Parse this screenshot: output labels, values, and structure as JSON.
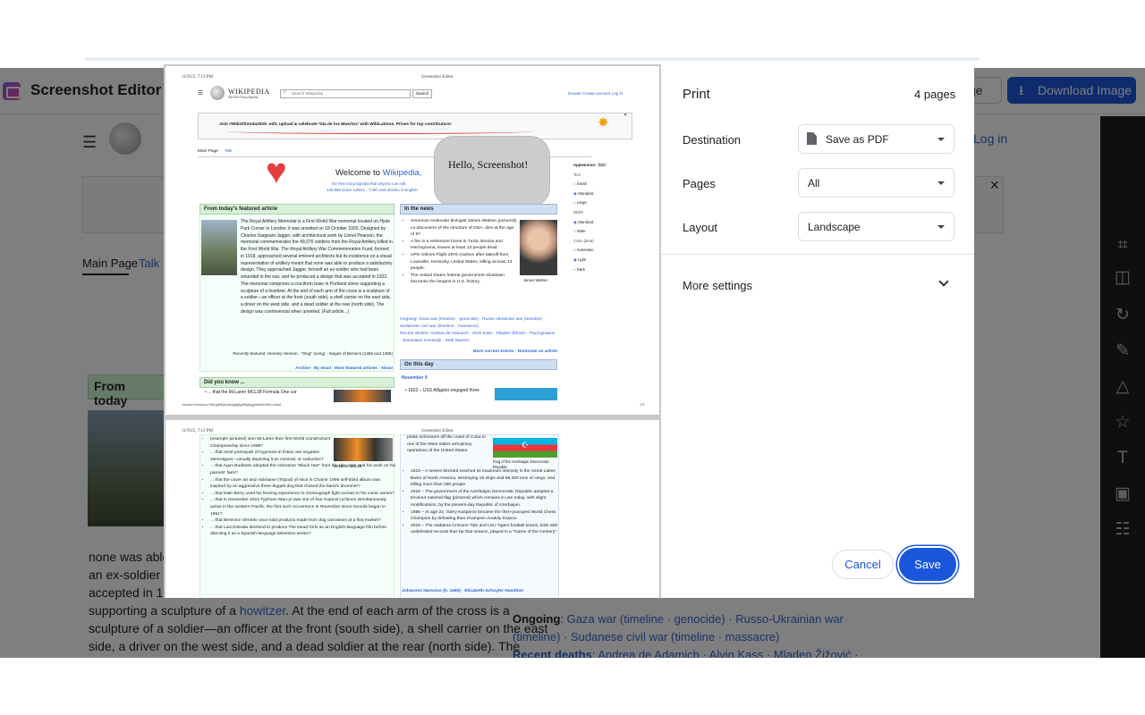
{
  "app": {
    "title": "Screenshot Editor",
    "secondary_button_label": "ge",
    "download_label": "Download Image"
  },
  "toolbar": {
    "icons": [
      "crop-icon",
      "compare-icon",
      "rotate-icon",
      "pencil-icon",
      "shapes-icon",
      "star-icon",
      "text-icon",
      "frame-icon",
      "adjust-icon"
    ]
  },
  "underlying": {
    "login": "Log in",
    "tabs": [
      "Main Page",
      "Talk"
    ],
    "featured_head": "From today",
    "article_lines": [
      "none was able t",
      "an ex-soldier wh",
      "accepted in 192"
    ],
    "howitzer_prefix": "supporting a sculpture of a ",
    "howitzer_link": "howitzer",
    "howitzer_suffix": ". At the end of each arm of the cross is a",
    "line5": "sculpture of a soldier—an officer at the front (south side), a shell carrier on the east",
    "line6": "side, a driver on the west side, and a dead soldier at the rear (north side). The",
    "ongoing_label": "Ongoing",
    "ongoing_text": ": Gaza war (timeline · genocide) · Russo-Ukrainian war",
    "ongoing_text2": "(timeline) · Sudanese civil war (timeline · massacre)",
    "recent_label": "Recent deaths",
    "recent_text": ": Andrea de Adamich · Alvin Kass · Mladen Žižović ·"
  },
  "print": {
    "title": "Print",
    "pages_count": "4 pages",
    "destination_label": "Destination",
    "destination_value": "Save as PDF",
    "pages_label": "Pages",
    "pages_value": "All",
    "layout_label": "Layout",
    "layout_value": "Landscape",
    "more_settings": "More settings",
    "cancel": "Cancel",
    "save": "Save"
  },
  "preview_page1": {
    "date": "11/9/25, 7:13 PM",
    "header_center": "Screenshot Editor",
    "wiki_name": "WIKIPEDIA",
    "wiki_tagline": "The Free Encyclopedia",
    "search_placeholder": "Search Wikipedia",
    "search_button": "Search",
    "links": [
      "Donate",
      "Create account",
      "Log in"
    ],
    "banner": "Join #WikiOfrenda2025: edit, upload & celebrate 'Día de los Muertos' with WikiLatinos. Prizes for top contributors!",
    "tabs": [
      "Main Page",
      "Talk"
    ],
    "welcome_prefix": "Welcome to ",
    "welcome_link": "Wikipedia,",
    "welcome_sub1": "the free encyclopedia that anyone can edit.",
    "welcome_sub2": "140,669 active editors · 7,087,444 articles in English",
    "speech_bubble": "Hello, Screenshot!",
    "appearance_title": "Appearance",
    "appearance_hide": "hide",
    "appearance_text_label": "Text",
    "appearance_text_options": [
      "Small",
      "Standard",
      "Large"
    ],
    "appearance_width_label": "Width",
    "appearance_width_options": [
      "Standard",
      "Wide"
    ],
    "appearance_color_label": "Color (beta)",
    "appearance_color_options": [
      "Automatic",
      "Light",
      "Dark"
    ],
    "featured_head": "From today's featured article",
    "featured_text": "The Royal Artillery Memorial is a First World War memorial located on Hyde Park Corner in London; it was unveiled on 18 October 1925. Designed by Charles Sargeant Jagger, with architectural work by Lionel Pearson, the memorial commemorates the 49,076 soldiers from the Royal Artillery killed in the First World War. The Royal Artillery War Commemoration Fund, formed in 1918, approached several eminent architects but its insistence on a visual representation of artillery meant that none was able to produce a satisfactory design. They approached Jagger, himself an ex-soldier who had been wounded in the war, and he produced a design that was accepted in 1922. The memorial comprises a cruciform base in Portland stone supporting a sculpture of a howitzer. At the end of each arm of the cross is a sculpture of a soldier—an officer at the front (south side), a shell carrier on the east side, a driver on the west side, and a dead soldier at the rear (north side). The design was controversial when unveiled. (Full article...)",
    "recently_featured": "Recently featured: Hensley Henson · \"Slug\" (song) · Sieges of Berwick (1355 and 1356)",
    "archive_links": "Archive · By email · More featured articles · About",
    "dyk_head": "Did you know ...",
    "dyk_text": "• ... that the McLaren MCL38 Formula One car",
    "news_head": "In the news",
    "news_items": [
      "American molecular biologist James Watson (pictured), co-discoverer of the structure of DNA, dies at the age of 97.",
      "A fire in a retirement home in Tuzla, Bosnia and Herzegovina, leaves at least 13 people dead.",
      "UPS Airlines Flight 2976 crashes after takeoff from Louisville, Kentucky, United States, killing at least 14 people.",
      "The United States federal government shutdown becomes the longest in U.S. history."
    ],
    "news_photo_caption": "James Watson",
    "ongoing": "Ongoing: Gaza war (timeline · genocide) · Russo-Ukrainian war (timeline) · Sudanese civil war (timeline · massacre)",
    "recent_deaths": "Recent deaths: Andrea de Adamich · Alvin Kass · Mladen Žižović · Paul Ignatius · Stanislaus Kennedy · Setti Warren",
    "more_events": "More current events · Nominate an article",
    "otd_head": "On this day",
    "otd_date": "November 9",
    "otd_item": "• 1822 – USS Alligator engaged three",
    "footer_url": "chrome-extension://bdcgdnkjhcdmngfpjkpdfkphjgmaebtd/editor.html",
    "footer_page": "1/4"
  },
  "preview_page2": {
    "date": "11/9/25, 7:13 PM",
    "header_center": "Screenshot Editor",
    "left_items": [
      "(example pictured) won McLaren their first World Constructors' Championship since 1998?",
      "... that most portrayals of hypnosis in fiction are negative stereotypes—usually depicting it as criminal, or seductive?",
      "... that Agus Budianto adopted the nickname \"Black Hoe\" from his skin color and his work on his parents' farm?",
      "... that the cover art and nickname (Tripod) of Alice in Chains' 1995 self-titled album was inspired by an aggressive three-legged dog that chased the band's drummer?",
      "... that Dale Berry used his fencing experience to choreograph fight scenes in his comic series?",
      "... that in November 2024 Typhoon Man-yi was one of four tropical cyclones simultaneously active in the western Pacific, the first such occurrence in November since records began in 1951?",
      "... that Berenice Olmedo once sold products made from dog carcasses at a flea market?",
      "... that Luis Estrada declined to produce The Dead Girls as an English-language film before directing it as a Spanish-language television series?"
    ],
    "car_caption": "McLaren MCL38",
    "right_intro": "pirate schooners off the coast of Cuba in one of the West Indies anti-piracy operations of the United States.",
    "flag_caption": "Flag of the Azerbaijan Democratic Republic",
    "right_items": [
      "1913 – A severe blizzard reached its maximum intensity in the Great Lakes Basin of North America, destroying 19 ships and 68,300 tons of cargo, and killing more than 250 people.",
      "1918 – The government of the Azerbaijan Democratic Republic adopted a tricolour national flag (pictured) which remains in use today, with slight modifications, by the present-day Republic of Azerbaijan.",
      "1985 – At age 22, Garry Kasparov became the then-youngest World Chess Champion by defeating then-champion Anatoly Karpov.",
      "2019 – The Alabama Crimson Tide and LSU Tigers football teams, both with undefeated records thus far that season, played in a \"Game of the Century\"."
    ],
    "births": "Johannes Narssius (b. 1580) · Elizabeth Schuyler Hamilton"
  },
  "colors": {
    "accent": "#1a56db",
    "dialog_save": "#1a56db",
    "toolbar_bg": "#1f1f1f",
    "featured_bg": "#d7f0d7",
    "news_bg": "#cedff2"
  }
}
